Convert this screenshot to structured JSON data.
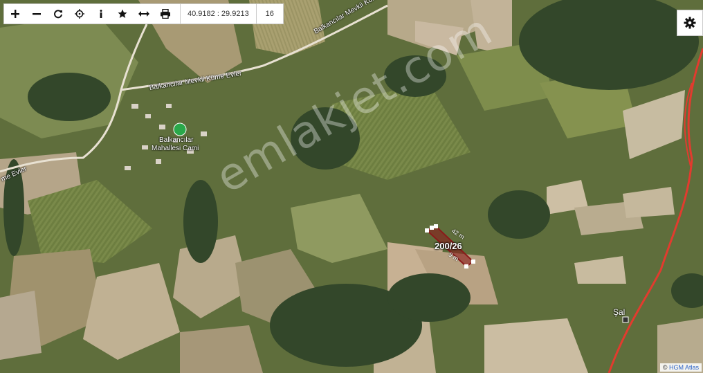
{
  "toolbar": {
    "buttons": [
      {
        "name": "zoom-in-button",
        "icon": "plus-icon"
      },
      {
        "name": "zoom-out-button",
        "icon": "minus-icon"
      },
      {
        "name": "refresh-button",
        "icon": "refresh-icon"
      },
      {
        "name": "locate-button",
        "icon": "crosshair-icon"
      },
      {
        "name": "info-button",
        "icon": "info-icon"
      },
      {
        "name": "favorite-button",
        "icon": "star-icon"
      },
      {
        "name": "measure-button",
        "icon": "arrows-horizontal-icon"
      },
      {
        "name": "print-button",
        "icon": "printer-icon"
      }
    ],
    "coordinates": "40.9182 : 29.9213",
    "zoom_level": "16"
  },
  "settings": {
    "icon": "gear-icon"
  },
  "map": {
    "labels": {
      "road_upper": "Balkancılar Mevkii Küme Evler",
      "road_left": "Balkancılar Mevkii Küme Evler",
      "road_far_left": "me Evler",
      "mosque_line1": "Balkancılar",
      "mosque_line2": "Mahallesi Cami",
      "place_right": "Şal"
    },
    "watermark": "emlakjet.com",
    "parcel": {
      "label": "200/26",
      "length_a": "42 m",
      "length_b": "9 m",
      "color": "#8b1a1a"
    },
    "road_color": "#e23b2e"
  },
  "attribution": {
    "symbol": "©",
    "text": "HGM Atlas"
  }
}
